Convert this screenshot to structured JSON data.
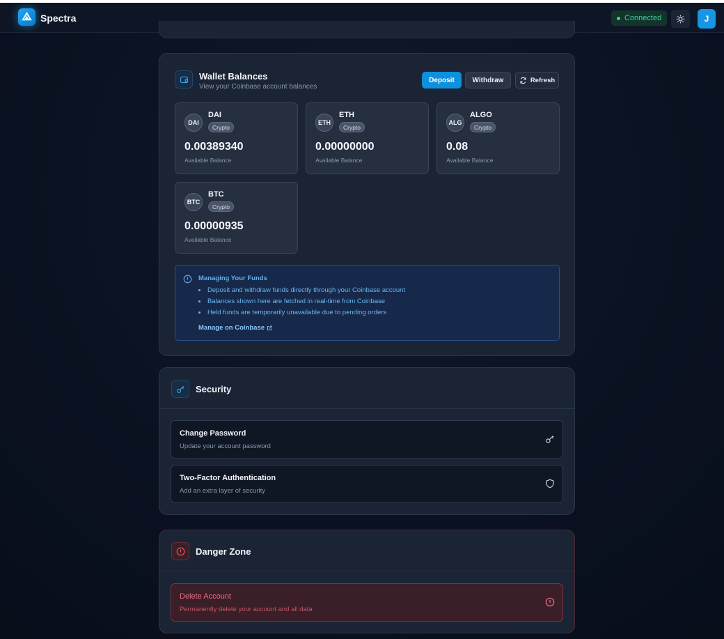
{
  "navbar": {
    "brand": "Spectra",
    "status": "Connected",
    "avatar_initial": "J"
  },
  "wallet": {
    "title": "Wallet Balances",
    "subtitle": "View your Coinbase account balances",
    "deposit_label": "Deposit",
    "withdraw_label": "Withdraw",
    "refresh_label": "Refresh",
    "balances": [
      {
        "badge": "DAI",
        "symbol": "DAI",
        "type": "Crypto",
        "amount": "0.00389340",
        "caption": "Available Balance"
      },
      {
        "badge": "ETH",
        "symbol": "ETH",
        "type": "Crypto",
        "amount": "0.00000000",
        "caption": "Available Balance"
      },
      {
        "badge": "ALG",
        "symbol": "ALGO",
        "type": "Crypto",
        "amount": "0.08",
        "caption": "Available Balance"
      },
      {
        "badge": "BTC",
        "symbol": "BTC",
        "type": "Crypto",
        "amount": "0.00000935",
        "caption": "Available Balance"
      }
    ],
    "info": {
      "title": "Managing Your Funds",
      "items": [
        "Deposit and withdraw funds directly through your Coinbase account",
        "Balances shown here are fetched in real-time from Coinbase",
        "Held funds are temporarily unavailable due to pending orders"
      ],
      "link": "Manage on Coinbase"
    }
  },
  "security": {
    "title": "Security",
    "items": [
      {
        "title": "Change Password",
        "subtitle": "Update your account password"
      },
      {
        "title": "Two-Factor Authentication",
        "subtitle": "Add an extra layer of security"
      }
    ]
  },
  "danger": {
    "title": "Danger Zone",
    "item": {
      "title": "Delete Account",
      "subtitle": "Permanently delete your account and all data"
    }
  },
  "colors": {
    "accent": "#0e90dd",
    "success": "#35d39a",
    "danger": "#f0707e"
  }
}
